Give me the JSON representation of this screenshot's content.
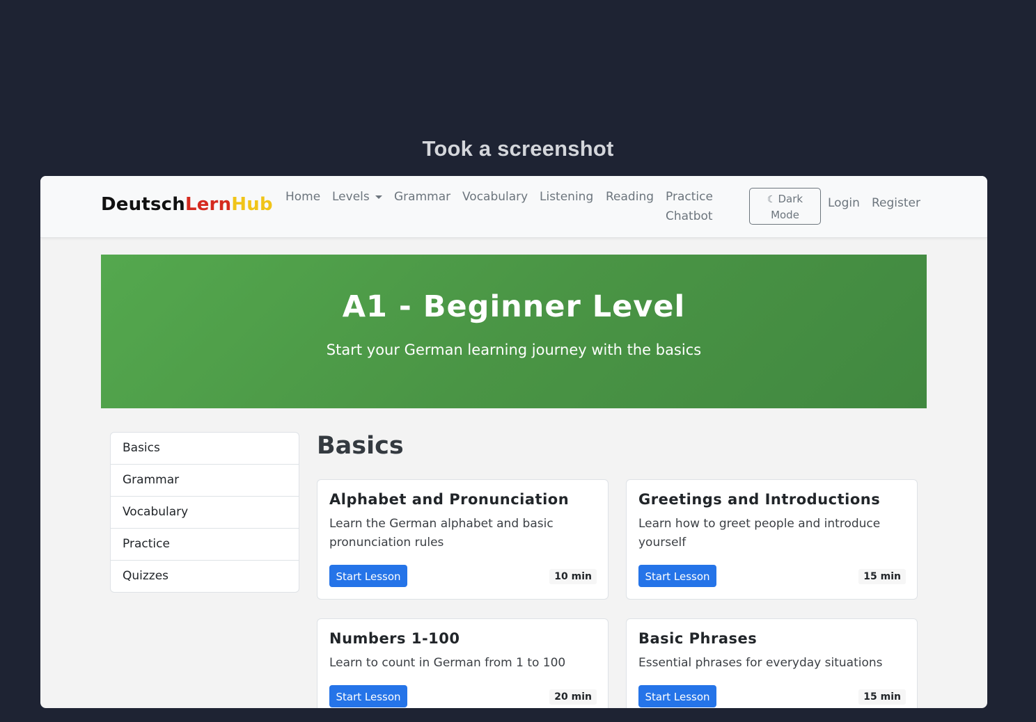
{
  "caption": "Took a screenshot",
  "navbar": {
    "brand": {
      "part1": "Deutsch",
      "part2": "Lern",
      "part3": "Hub"
    },
    "links": {
      "home": "Home",
      "levels": "Levels",
      "grammar": "Grammar",
      "vocabulary": "Vocabulary",
      "listening": "Listening",
      "reading": "Reading",
      "practice_line1": "Practice",
      "practice_line2": "Chatbot"
    },
    "dark_mode": {
      "icon": "moon-icon",
      "line1": "Dark",
      "line2": "Mode"
    },
    "login": "Login",
    "register": "Register"
  },
  "hero": {
    "title": "A1 - Beginner Level",
    "subtitle": "Start your German learning journey with the basics"
  },
  "sidebar": {
    "items": [
      {
        "label": "Basics"
      },
      {
        "label": "Grammar"
      },
      {
        "label": "Vocabulary"
      },
      {
        "label": "Practice"
      },
      {
        "label": "Quizzes"
      }
    ]
  },
  "section": {
    "title": "Basics"
  },
  "lessons": [
    {
      "title": "Alphabet and Pronunciation",
      "description": "Learn the German alphabet and basic pronunciation rules",
      "button": "Start Lesson",
      "duration": "10 min"
    },
    {
      "title": "Greetings and Introductions",
      "description": "Learn how to greet people and introduce yourself",
      "button": "Start Lesson",
      "duration": "15 min"
    },
    {
      "title": "Numbers 1-100",
      "description": "Learn to count in German from 1 to 100",
      "button": "Start Lesson",
      "duration": "20 min"
    },
    {
      "title": "Basic Phrases",
      "description": "Essential phrases for everyday situations",
      "button": "Start Lesson",
      "duration": "15 min"
    }
  ],
  "colors": {
    "brand_red": "#d52a1f",
    "brand_gold": "#f0c419",
    "hero_green": "#4a9545",
    "primary_blue": "#2574e8"
  }
}
